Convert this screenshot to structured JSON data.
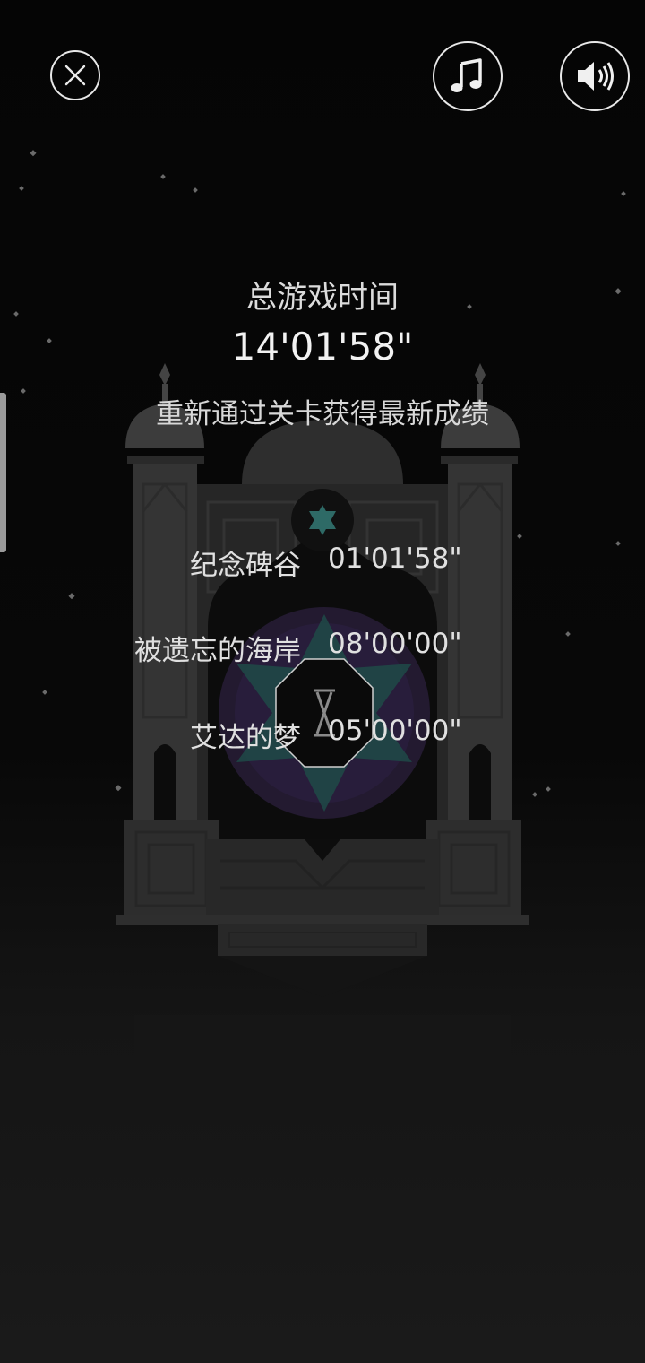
{
  "header": {
    "close_icon": "close-icon",
    "music_icon": "music-note-icon",
    "sound_icon": "speaker-icon"
  },
  "summary": {
    "title": "总游戏时间",
    "total_time": "14'01'58\"",
    "hint": "重新通过关卡获得最新成绩"
  },
  "levels": [
    {
      "name": "纪念碑谷",
      "time": "01'01'58\""
    },
    {
      "name": "被遗忘的海岸",
      "time": "08'00'00\""
    },
    {
      "name": "艾达的梦",
      "time": "05'00'00\""
    }
  ],
  "colors": {
    "background": "#050505",
    "text": "#e6e6e6",
    "monument": "#3a3a3a",
    "accent_teal": "#2f6f6a",
    "accent_purple": "#3b2a55"
  }
}
